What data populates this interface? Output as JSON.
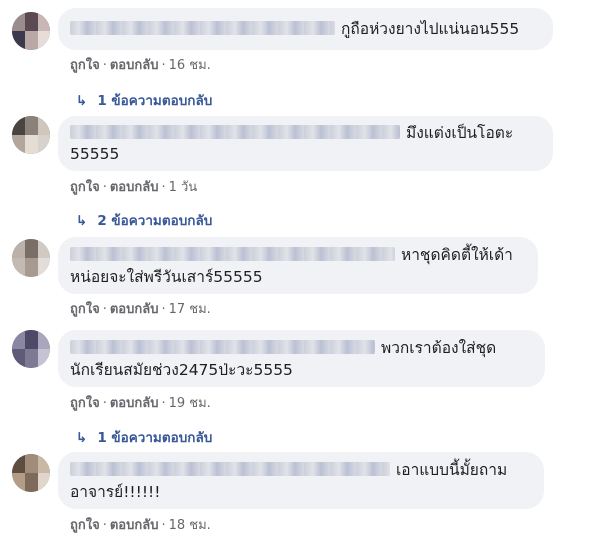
{
  "comments": [
    {
      "text_line1": "กูถือห่วงยางไปแน่นอน555",
      "text_line2": "",
      "like_label": "ถูกใจ",
      "reply_label": "ตอบกลับ",
      "time": "16 ชม.",
      "replies_label": "1 ข้อความตอบกลับ"
    },
    {
      "text_line1": "มึงแต่งเป็นโอตะ",
      "text_line2": "55555",
      "like_label": "ถูกใจ",
      "reply_label": "ตอบกลับ",
      "time": "1 วัน",
      "replies_label": "2 ข้อความตอบกลับ"
    },
    {
      "text_line1": "หาชุดคิดตี้ให้เด้า",
      "text_line2": "หน่อยจะใส่พรีวันเสาร์55555",
      "like_label": "ถูกใจ",
      "reply_label": "ตอบกลับ",
      "time": "17 ชม.",
      "replies_label": ""
    },
    {
      "text_line1": "พวกเราต้องใส่ชุด",
      "text_line2": "นักเรียนสมัยช่วง2475ป่ะวะ5555",
      "like_label": "ถูกใจ",
      "reply_label": "ตอบกลับ",
      "time": "19 ชม.",
      "replies_label": "1 ข้อความตอบกลับ"
    },
    {
      "text_line1": "เอาแบบนี้มั้ยถาม",
      "text_line2": "อาจารย์!!!!!!",
      "like_label": "ถูกใจ",
      "reply_label": "ตอบกลับ",
      "time": "18 ชม.",
      "replies_label": ""
    }
  ],
  "reply_arrow_icon": "reply-arrow-icon",
  "colors": {
    "bubble": "#f0f2f5",
    "text": "#1c1e21",
    "meta": "#65676b",
    "link": "#385898"
  }
}
